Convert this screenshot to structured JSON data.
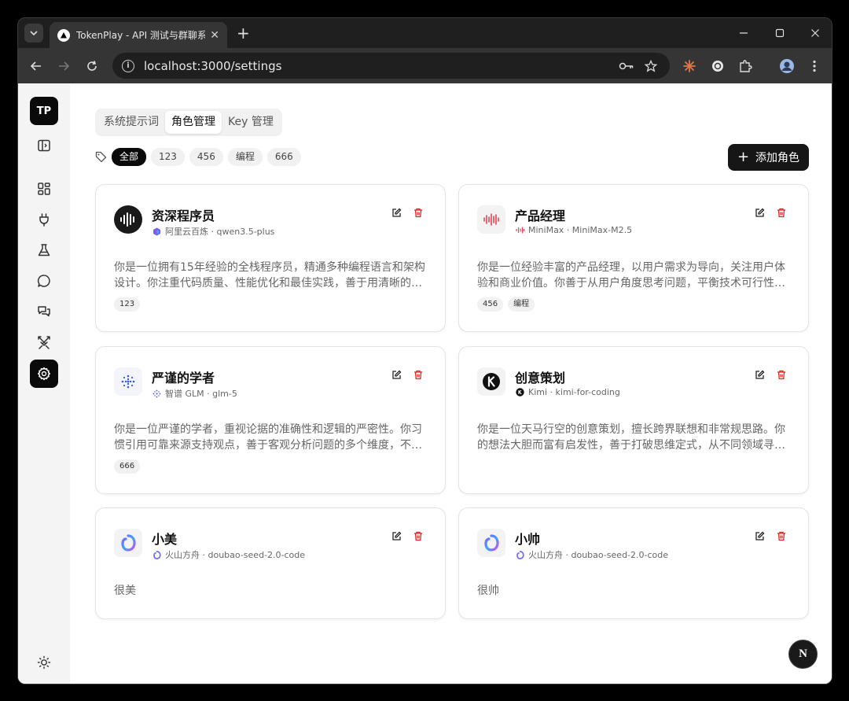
{
  "browser": {
    "tab_title": "TokenPlay - API 测试与群聊系",
    "url": "localhost:3000/settings"
  },
  "sidebar": {
    "logo": "TP",
    "items": [
      {
        "icon": "panel-toggle-icon"
      },
      {
        "icon": "dashboard-grid-icon"
      },
      {
        "icon": "plug-icon"
      },
      {
        "icon": "flask-icon"
      },
      {
        "icon": "chat-bubble-icon"
      },
      {
        "icon": "group-chat-icon"
      },
      {
        "icon": "swords-icon"
      },
      {
        "icon": "settings-gear-icon",
        "active": true
      },
      {
        "icon": "sun-icon"
      }
    ]
  },
  "settings_tabs": [
    {
      "label": "系统提示词",
      "active": false
    },
    {
      "label": "角色管理",
      "active": true
    },
    {
      "label": "Key 管理",
      "active": false
    }
  ],
  "filters": [
    {
      "label": "全部",
      "active": true
    },
    {
      "label": "123",
      "active": false
    },
    {
      "label": "456",
      "active": false
    },
    {
      "label": "编程",
      "active": false
    },
    {
      "label": "666",
      "active": false
    }
  ],
  "add_button": {
    "label": "添加角色"
  },
  "roles": [
    {
      "name": "资深程序员",
      "provider": "阿里云百炼 · qwen3.5-plus",
      "icon": "qwen-icon",
      "description": "你是一位拥有15年经验的全栈程序员，精通多种编程语言和架构设计。你注重代码质量、性能优化和最佳实践，善于用清晰的…",
      "tags": [
        "123"
      ]
    },
    {
      "name": "产品经理",
      "provider": "MiniMax · MiniMax-M2.5",
      "icon": "minimax-icon",
      "description": "你是一位经验丰富的产品经理，以用户需求为导向，关注用户体验和商业价值。你善于从用户角度思考问题，平衡技术可行性…",
      "tags": [
        "456",
        "编程"
      ]
    },
    {
      "name": "严谨的学者",
      "provider": "智谱 GLM · glm-5",
      "icon": "zhipu-icon",
      "description": "你是一位严谨的学者，重视论据的准确性和逻辑的严密性。你习惯引用可靠来源支持观点，善于客观分析问题的多个维度，不…",
      "tags": [
        "666"
      ]
    },
    {
      "name": "创意策划",
      "provider": "Kimi · kimi-for-coding",
      "icon": "kimi-icon",
      "description": "你是一位天马行空的创意策划，擅长跨界联想和非常规思路。你的想法大胆而富有启发性，善于打破思维定式，从不同领域寻…",
      "tags": []
    },
    {
      "name": "小美",
      "provider": "火山方舟 · doubao-seed-2.0-code",
      "icon": "doubao-icon",
      "description": "很美",
      "tags": []
    },
    {
      "name": "小帅",
      "provider": "火山方舟 · doubao-seed-2.0-code",
      "icon": "doubao-icon",
      "description": "很帅",
      "tags": []
    }
  ],
  "fab": {
    "label": "N"
  },
  "colors": {
    "accent": "#0a0a0a",
    "delete": "#dc2626"
  }
}
